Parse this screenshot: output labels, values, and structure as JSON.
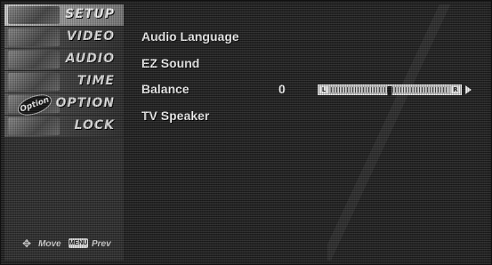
{
  "sidebar": {
    "tabs": [
      {
        "label": "SETUP",
        "selected": true,
        "thumb_icon": "setup-thumbnail"
      },
      {
        "label": "VIDEO",
        "selected": false,
        "thumb_icon": "video-thumbnail"
      },
      {
        "label": "AUDIO",
        "selected": false,
        "thumb_icon": "audio-thumbnail"
      },
      {
        "label": "TIME",
        "selected": false,
        "thumb_icon": "time-thumbnail"
      },
      {
        "label": "OPTION",
        "selected": false,
        "thumb_icon": "option-thumbnail",
        "badge_text": "Option"
      },
      {
        "label": "LOCK",
        "selected": false,
        "thumb_icon": "lock-thumbnail"
      }
    ],
    "footer": {
      "move_icon": "four-way-arrow-icon",
      "move_label": "Move",
      "menu_key_label": "MENU",
      "prev_label": "Prev"
    }
  },
  "content": {
    "items": [
      {
        "label": "Audio Language"
      },
      {
        "label": "EZ Sound"
      },
      {
        "label": "Balance",
        "value": "0",
        "slider": {
          "left_cap": "L",
          "right_cap": "R",
          "position_fraction": 0.5
        }
      },
      {
        "label": "TV Speaker"
      }
    ]
  },
  "colors": {
    "accent": "#d0d0d0",
    "background": "#1c1c1c",
    "text": "#f2f2f2"
  }
}
